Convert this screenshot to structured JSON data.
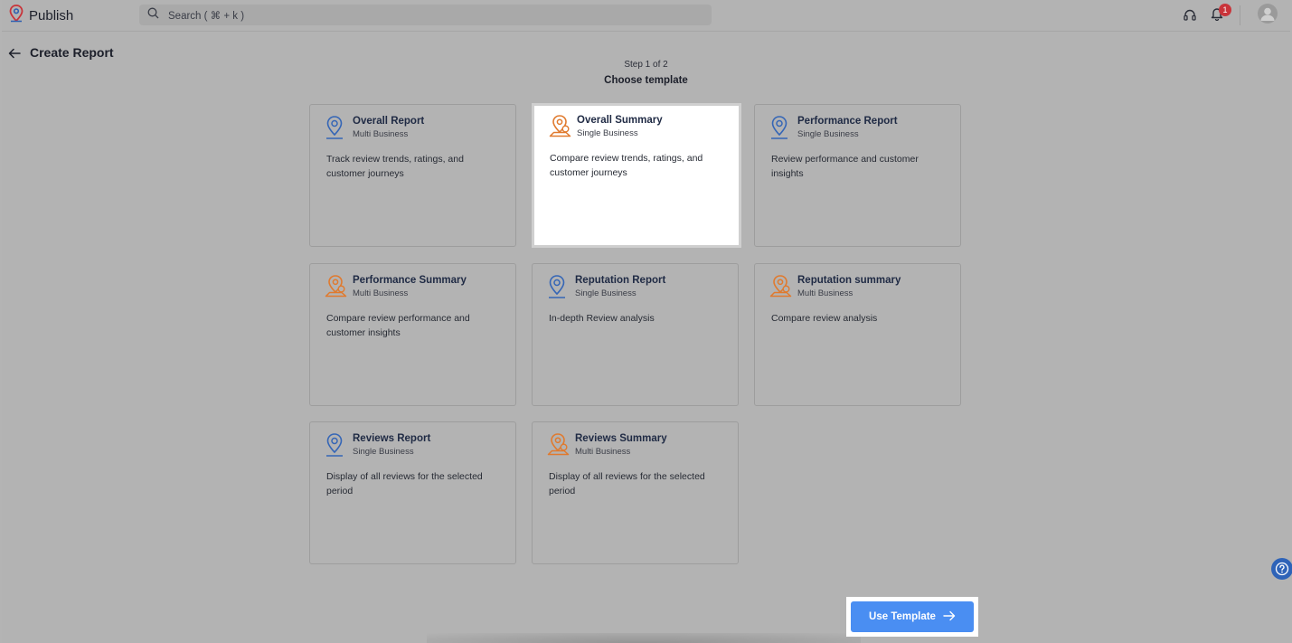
{
  "app": {
    "name": "Publish"
  },
  "search": {
    "placeholder": "Search ( ⌘ + k )"
  },
  "notifications": {
    "count": "1"
  },
  "page": {
    "title": "Create Report",
    "step": "Step 1 of 2",
    "step_title": "Choose template"
  },
  "colors": {
    "accent": "#4a8ef2",
    "icon_blue": "#3566b6",
    "icon_orange": "#e07a2e",
    "badge": "#c9343a"
  },
  "templates": [
    {
      "title": "Overall Report",
      "subtitle": "Multi Business",
      "description": "Track review trends, ratings, and customer journeys",
      "icon": "location-pin-icon",
      "selected": false
    },
    {
      "title": "Overall Summary",
      "subtitle": "Single Business",
      "description": "Compare review trends, ratings, and customer journeys",
      "icon": "map-pin-summary-icon",
      "selected": true
    },
    {
      "title": "Performance Report",
      "subtitle": "Single Business",
      "description": "Review performance and customer insights",
      "icon": "location-pin-icon",
      "selected": false
    },
    {
      "title": "Performance Summary",
      "subtitle": "Multi Business",
      "description": "Compare review performance and customer insights",
      "icon": "map-pin-summary-icon",
      "selected": false
    },
    {
      "title": "Reputation Report",
      "subtitle": "Single Business",
      "description": "In-depth Review analysis",
      "icon": "location-pin-icon",
      "selected": false
    },
    {
      "title": "Reputation summary",
      "subtitle": "Multi Business",
      "description": "Compare review analysis",
      "icon": "map-pin-summary-icon",
      "selected": false
    },
    {
      "title": "Reviews Report",
      "subtitle": "Single Business",
      "description": "Display of all reviews for the selected period",
      "icon": "location-pin-icon",
      "selected": false
    },
    {
      "title": "Reviews Summary",
      "subtitle": "Multi Business",
      "description": "Display of all reviews for the selected period",
      "icon": "map-pin-summary-icon",
      "selected": false
    }
  ],
  "footer": {
    "use_template_label": "Use Template"
  }
}
